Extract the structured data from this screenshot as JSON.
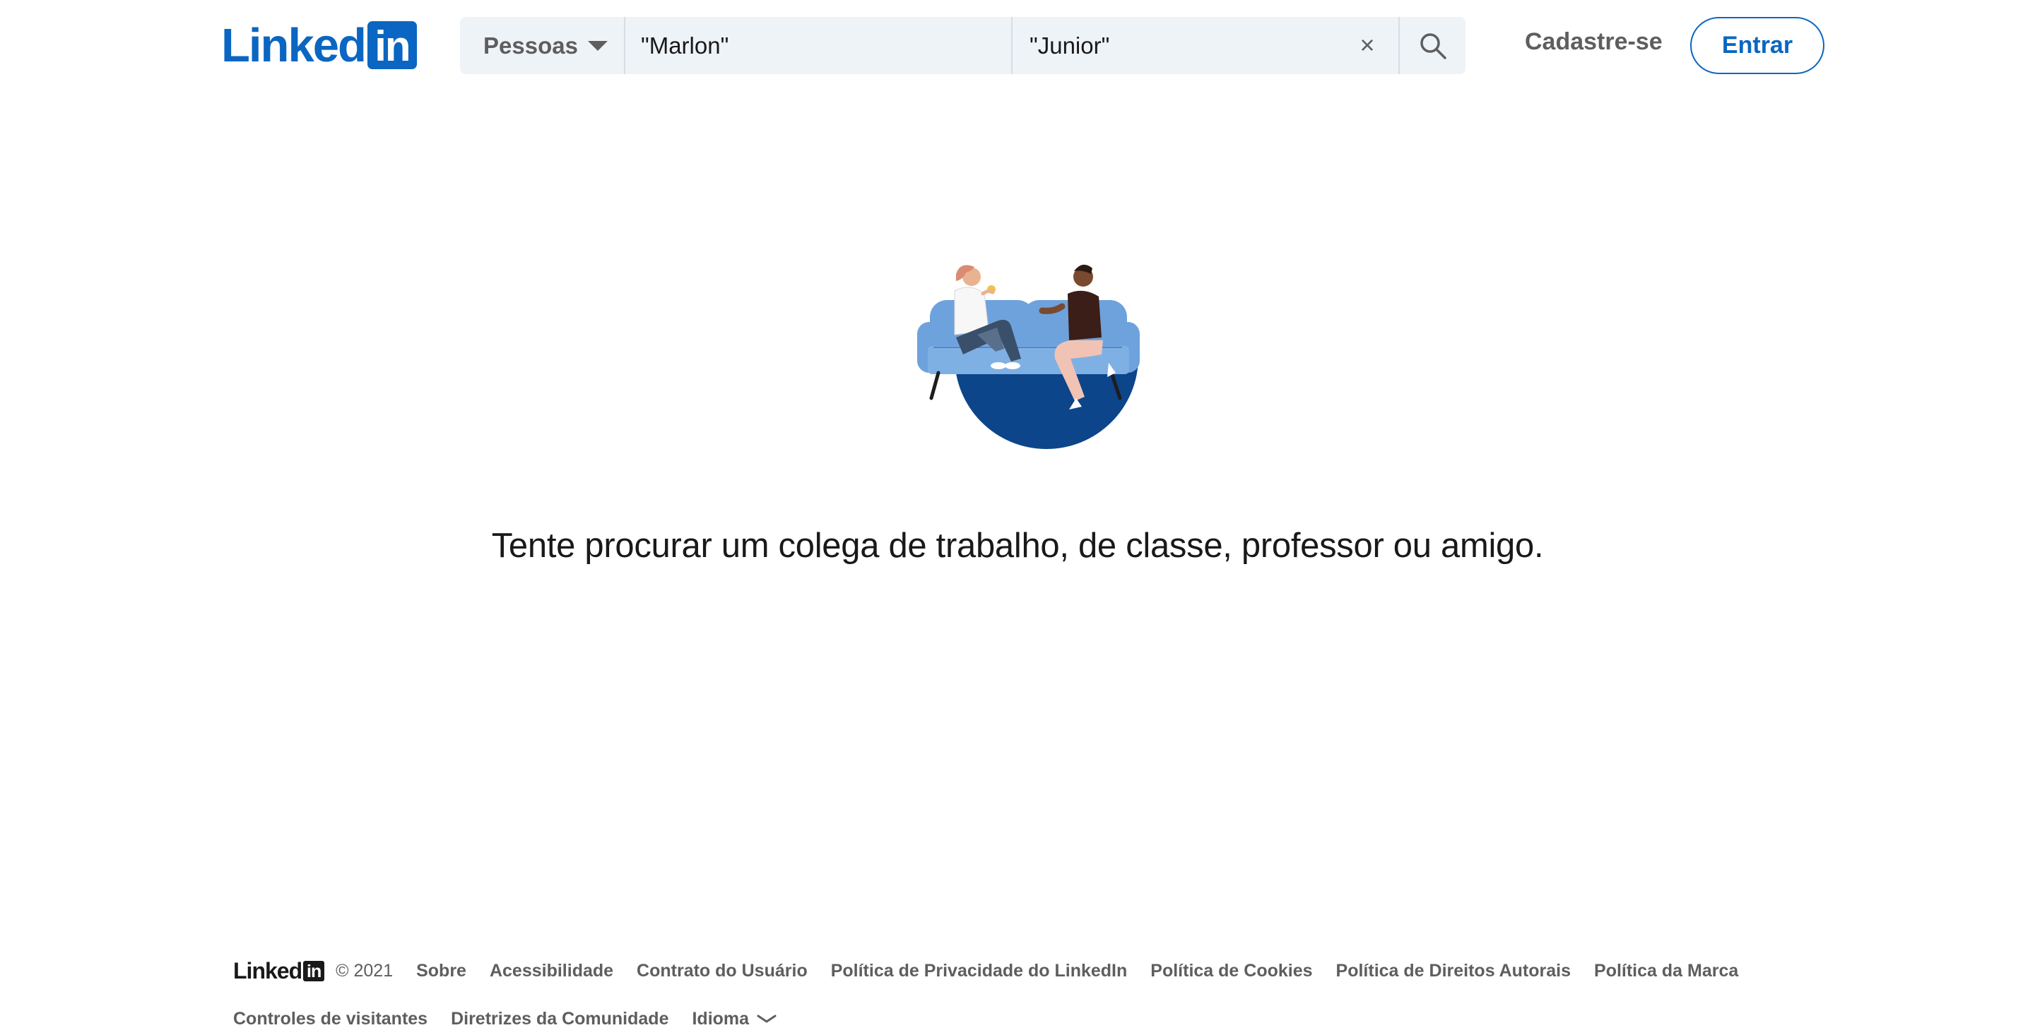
{
  "header": {
    "logo_text": "Linked",
    "logo_box_text": "in",
    "search": {
      "filter_label": "Pessoas",
      "first_name_value": "\"Marlon\"",
      "last_name_value": "\"Junior\"",
      "clear_glyph": "×"
    },
    "signup_label": "Cadastre-se",
    "signin_label": "Entrar"
  },
  "main": {
    "message": "Tente procurar um colega de trabalho, de classe, professor ou amigo."
  },
  "footer": {
    "logo_text": "Linked",
    "logo_box_text": "in",
    "copyright": "© 2021",
    "links_row1": [
      "Sobre",
      "Acessibilidade",
      "Contrato do Usuário",
      "Política de Privacidade do LinkedIn",
      "Política de Cookies",
      "Política de Direitos Autorais",
      "Política da Marca"
    ],
    "links_row2": [
      "Controles de visitantes",
      "Diretrizes da Comunidade"
    ],
    "language_label": "Idioma"
  },
  "colors": {
    "brand": "#0a66c2",
    "search_bg": "#eef3f8",
    "muted_text": "#5e5e5e",
    "illustration_navy": "#0c4589",
    "illustration_sofa": "#6ea2dc"
  },
  "icons": {
    "caret": "caret-down-icon",
    "clear": "close-icon",
    "search": "search-icon",
    "language_chevron": "chevron-down-icon",
    "illustration": "people-on-sofa-illustration"
  }
}
